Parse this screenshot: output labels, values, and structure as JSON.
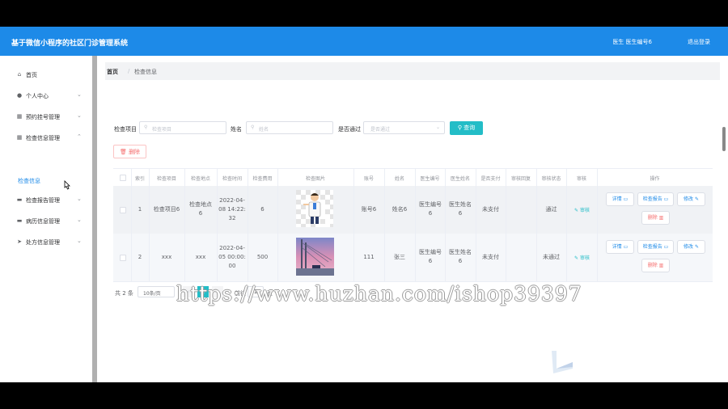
{
  "app": {
    "title": "基于微信小程序的社区门诊管理系统",
    "user": "医生 医生编号6",
    "logout": "退出登录"
  },
  "sidebar": {
    "items": [
      {
        "label": "首页",
        "icon": "home-icon"
      },
      {
        "label": "个人中心",
        "icon": "user-icon"
      },
      {
        "label": "预约挂号管理",
        "icon": "grid-icon"
      },
      {
        "label": "检查信息管理",
        "icon": "grid-icon"
      },
      {
        "label": "检查报告管理",
        "icon": "folder-icon"
      },
      {
        "label": "病历信息管理",
        "icon": "folder-icon"
      },
      {
        "label": "处方信息管理",
        "icon": "send-icon"
      }
    ],
    "active_sub": "检查信息"
  },
  "breadcrumb": {
    "home": "首页",
    "separator": "/",
    "current": "检查信息"
  },
  "filters": {
    "item_label": "检查项目",
    "item_placeholder": "检查项目",
    "name_label": "姓名",
    "name_placeholder": "姓名",
    "passed_label": "是否通过",
    "passed_placeholder": "是否通过",
    "search_button": "查询"
  },
  "delete_button": "删除",
  "table": {
    "headers": [
      "索引",
      "检查项目",
      "检查地点",
      "检查时间",
      "检查费用",
      "检查图片",
      "账号",
      "姓名",
      "医生编号",
      "医生姓名",
      "是否支付",
      "审核回复",
      "审核状态",
      "审核",
      "操作"
    ],
    "rows": [
      {
        "index": "1",
        "item": "检查项目6",
        "place": "检查地点6",
        "time": "2022-04-08 14:22:32",
        "fee": "6",
        "account": "账号6",
        "name": "姓名6",
        "doctor_no": "医生编号6",
        "doctor_name": "医生姓名6",
        "paid": "未支付",
        "reply": "",
        "status": "通过",
        "review": "审核"
      },
      {
        "index": "2",
        "item": "xxx",
        "place": "xxx",
        "time": "2022-04-05 00:00:00",
        "fee": "500",
        "account": "111",
        "name": "张三",
        "doctor_no": "医生编号6",
        "doctor_name": "医生姓名6",
        "paid": "未支付",
        "reply": "",
        "status": "未通过",
        "review": "审核"
      }
    ],
    "actions": {
      "detail": "详情",
      "report": "检查报告",
      "edit": "修改",
      "delete": "删除"
    }
  },
  "pagination": {
    "total": "共 2 条",
    "page_size": "10条/页",
    "current_page": "1",
    "goto_label": "前往",
    "goto_value": "1",
    "page_suffix": "页"
  },
  "watermark": "https://www.huzhan.com/ishop39397",
  "colors": {
    "primary": "#1d8ae8",
    "accent": "#23bdc7",
    "danger": "#f56c6c"
  }
}
